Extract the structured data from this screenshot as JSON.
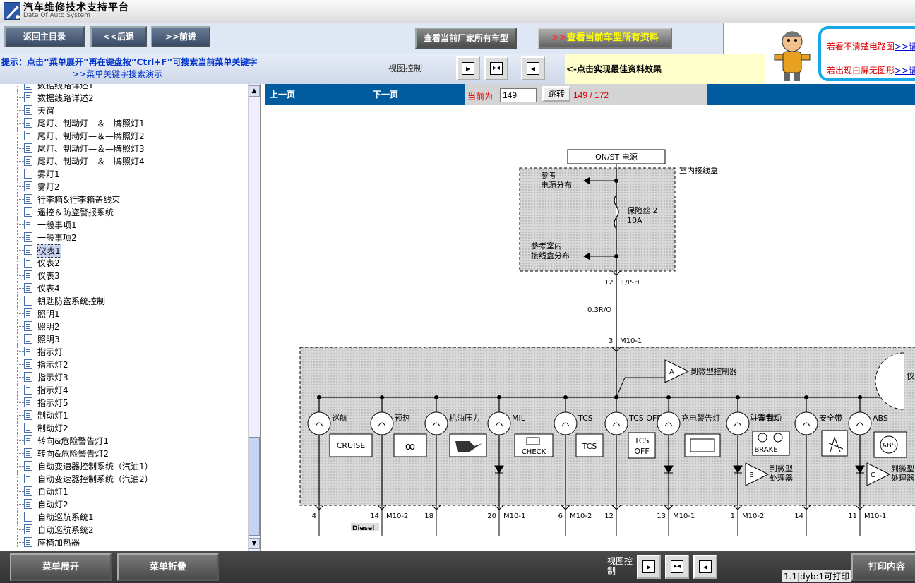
{
  "app": {
    "title": "汽车维修技术支持平台",
    "subtitle": "Data Of Auto System"
  },
  "nav": {
    "home": "返回主目录",
    "back": "<<后退",
    "forward": ">>前进",
    "view_all_models": "查看当前厂家所有车型",
    "view_current_arrows": ">>",
    "view_current": "查看当前车型所有资料"
  },
  "ad": {
    "line1": "若看不清楚电路图",
    "link1": ">>请",
    "line2": "若出现白屏无图形",
    "link2": ">>请"
  },
  "hint": {
    "text": "提示：点击“菜单展开”再在键盘按“Ctrl+F”可搜索当前菜单关键字",
    "link": ">>菜单关键字搜索演示"
  },
  "view_control": {
    "label": "视图控制",
    "best_effect": "<-点击实现最佳资料效果"
  },
  "tree": {
    "items": [
      "数据线路详述1",
      "数据线路详述2",
      "天窗",
      "尾灯、制动灯—＆—牌照灯1",
      "尾灯、制动灯—＆—牌照灯2",
      "尾灯、制动灯—＆—牌照灯3",
      "尾灯、制动灯—＆—牌照灯4",
      "雾灯1",
      "雾灯2",
      "行李箱&行李箱盖线束",
      "遥控＆防盗警报系统",
      "一般事项1",
      "一般事项2",
      "仪表1",
      "仪表2",
      "仪表3",
      "仪表4",
      "钥匙防盗系统控制",
      "照明1",
      "照明2",
      "照明3",
      "指示灯",
      "指示灯2",
      "指示灯3",
      "指示灯4",
      "指示灯5",
      "制动灯1",
      "制动灯2",
      "转向&危险警告灯1",
      "转向&危险警告灯2",
      "自动变速器控制系统（汽油1）",
      "自动变速器控制系统（汽油2）",
      "自动灯1",
      "自动灯2",
      "自动巡航系统1",
      "自动巡航系统2",
      "座椅加热器"
    ],
    "selected": "仪表1"
  },
  "pager": {
    "prev": "上一页",
    "next": "下一页",
    "current_label": "当前为",
    "current_value": "149",
    "jump": "跳转",
    "count": "149 / 172"
  },
  "diagram": {
    "power": "ON/ST 电源",
    "junction_box": "室内接线盒",
    "ref_power": "参考",
    "ref_power2": "电源分布",
    "fuse": "保险丝 2",
    "fuse_amp": "10A",
    "ref_jb": "参考室内",
    "ref_jb2": "接线盒分布",
    "conn1_pin": "12",
    "conn1": "1/P-H",
    "wire": "0.3R/O",
    "conn2_pin": "3",
    "conn2": "M10-1",
    "to_micro": "到微型控制器",
    "lamps": [
      "巡航",
      "预热",
      "机油压力",
      "MIL",
      "TCS",
      "TCS OFF",
      "充电警告灯",
      "驻车制动",
      "安全带",
      "ABS"
    ],
    "park_brake2": "警告灯",
    "icon_cruise": "CRUISE",
    "icon_check": "CHECK",
    "icon_tcs": "TCS",
    "icon_tcsoff1": "TCS",
    "icon_tcsoff2": "OFF",
    "icon_brake": "BRAKE",
    "icon_abs": "ABS",
    "to_proc": "到微型",
    "to_proc2": "处理器",
    "bottom_pins": [
      {
        "n": "4",
        "c": ""
      },
      {
        "n": "14",
        "c": "M10-2"
      },
      {
        "n": "18",
        "c": ""
      },
      {
        "n": "20",
        "c": "M10-1"
      },
      {
        "n": "6",
        "c": "M10-2"
      },
      {
        "n": "12",
        "c": ""
      },
      {
        "n": "13",
        "c": "M10-1"
      },
      {
        "n": "1",
        "c": "M10-2"
      },
      {
        "n": "14",
        "c": ""
      },
      {
        "n": "11",
        "c": "M10-1"
      }
    ],
    "diesel": "Diesel",
    "edge": "仪"
  },
  "bottom": {
    "expand": "菜单展开",
    "collapse": "菜单折叠",
    "view_control": "视图控制",
    "print_status": "1.1|dyb:1可打印",
    "print": "打印内容"
  }
}
